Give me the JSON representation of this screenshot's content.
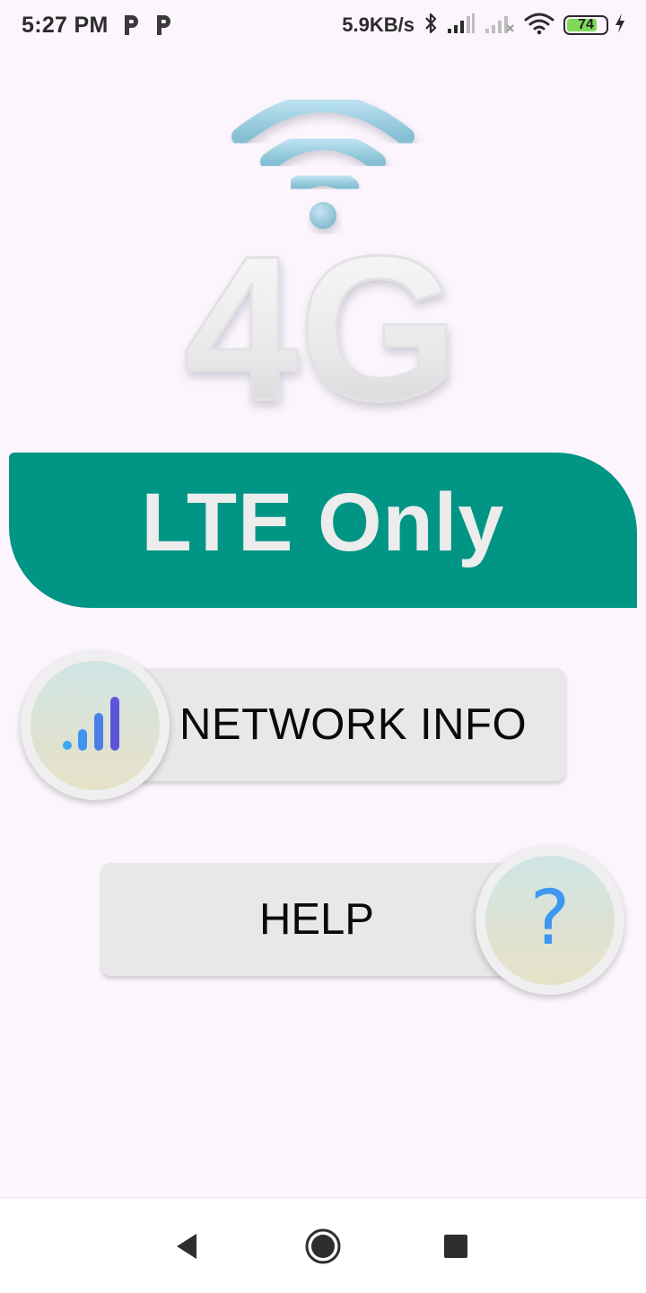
{
  "status_bar": {
    "time": "5:27 PM",
    "notification_icons": [
      "p-app-icon",
      "p-app-icon"
    ],
    "net_speed": "5.9KB/s",
    "battery_level": "74",
    "icons": [
      "bluetooth-icon",
      "cell-signal-icon",
      "cell-signal-no-service-icon",
      "wifi-icon",
      "battery-icon",
      "charging-bolt-icon"
    ]
  },
  "hero": {
    "graphic": "4G",
    "icon": "wifi-4g-logo"
  },
  "banner": {
    "title": "LTE Only",
    "color": "#009585"
  },
  "buttons": {
    "network_info": {
      "label": "NETWORK INFO",
      "icon": "signal-bars-icon"
    },
    "help": {
      "label": "HELP",
      "icon": "question-mark-icon",
      "glyph": "?"
    }
  },
  "nav_bar": {
    "items": [
      "back-icon",
      "home-icon",
      "recents-icon"
    ]
  }
}
